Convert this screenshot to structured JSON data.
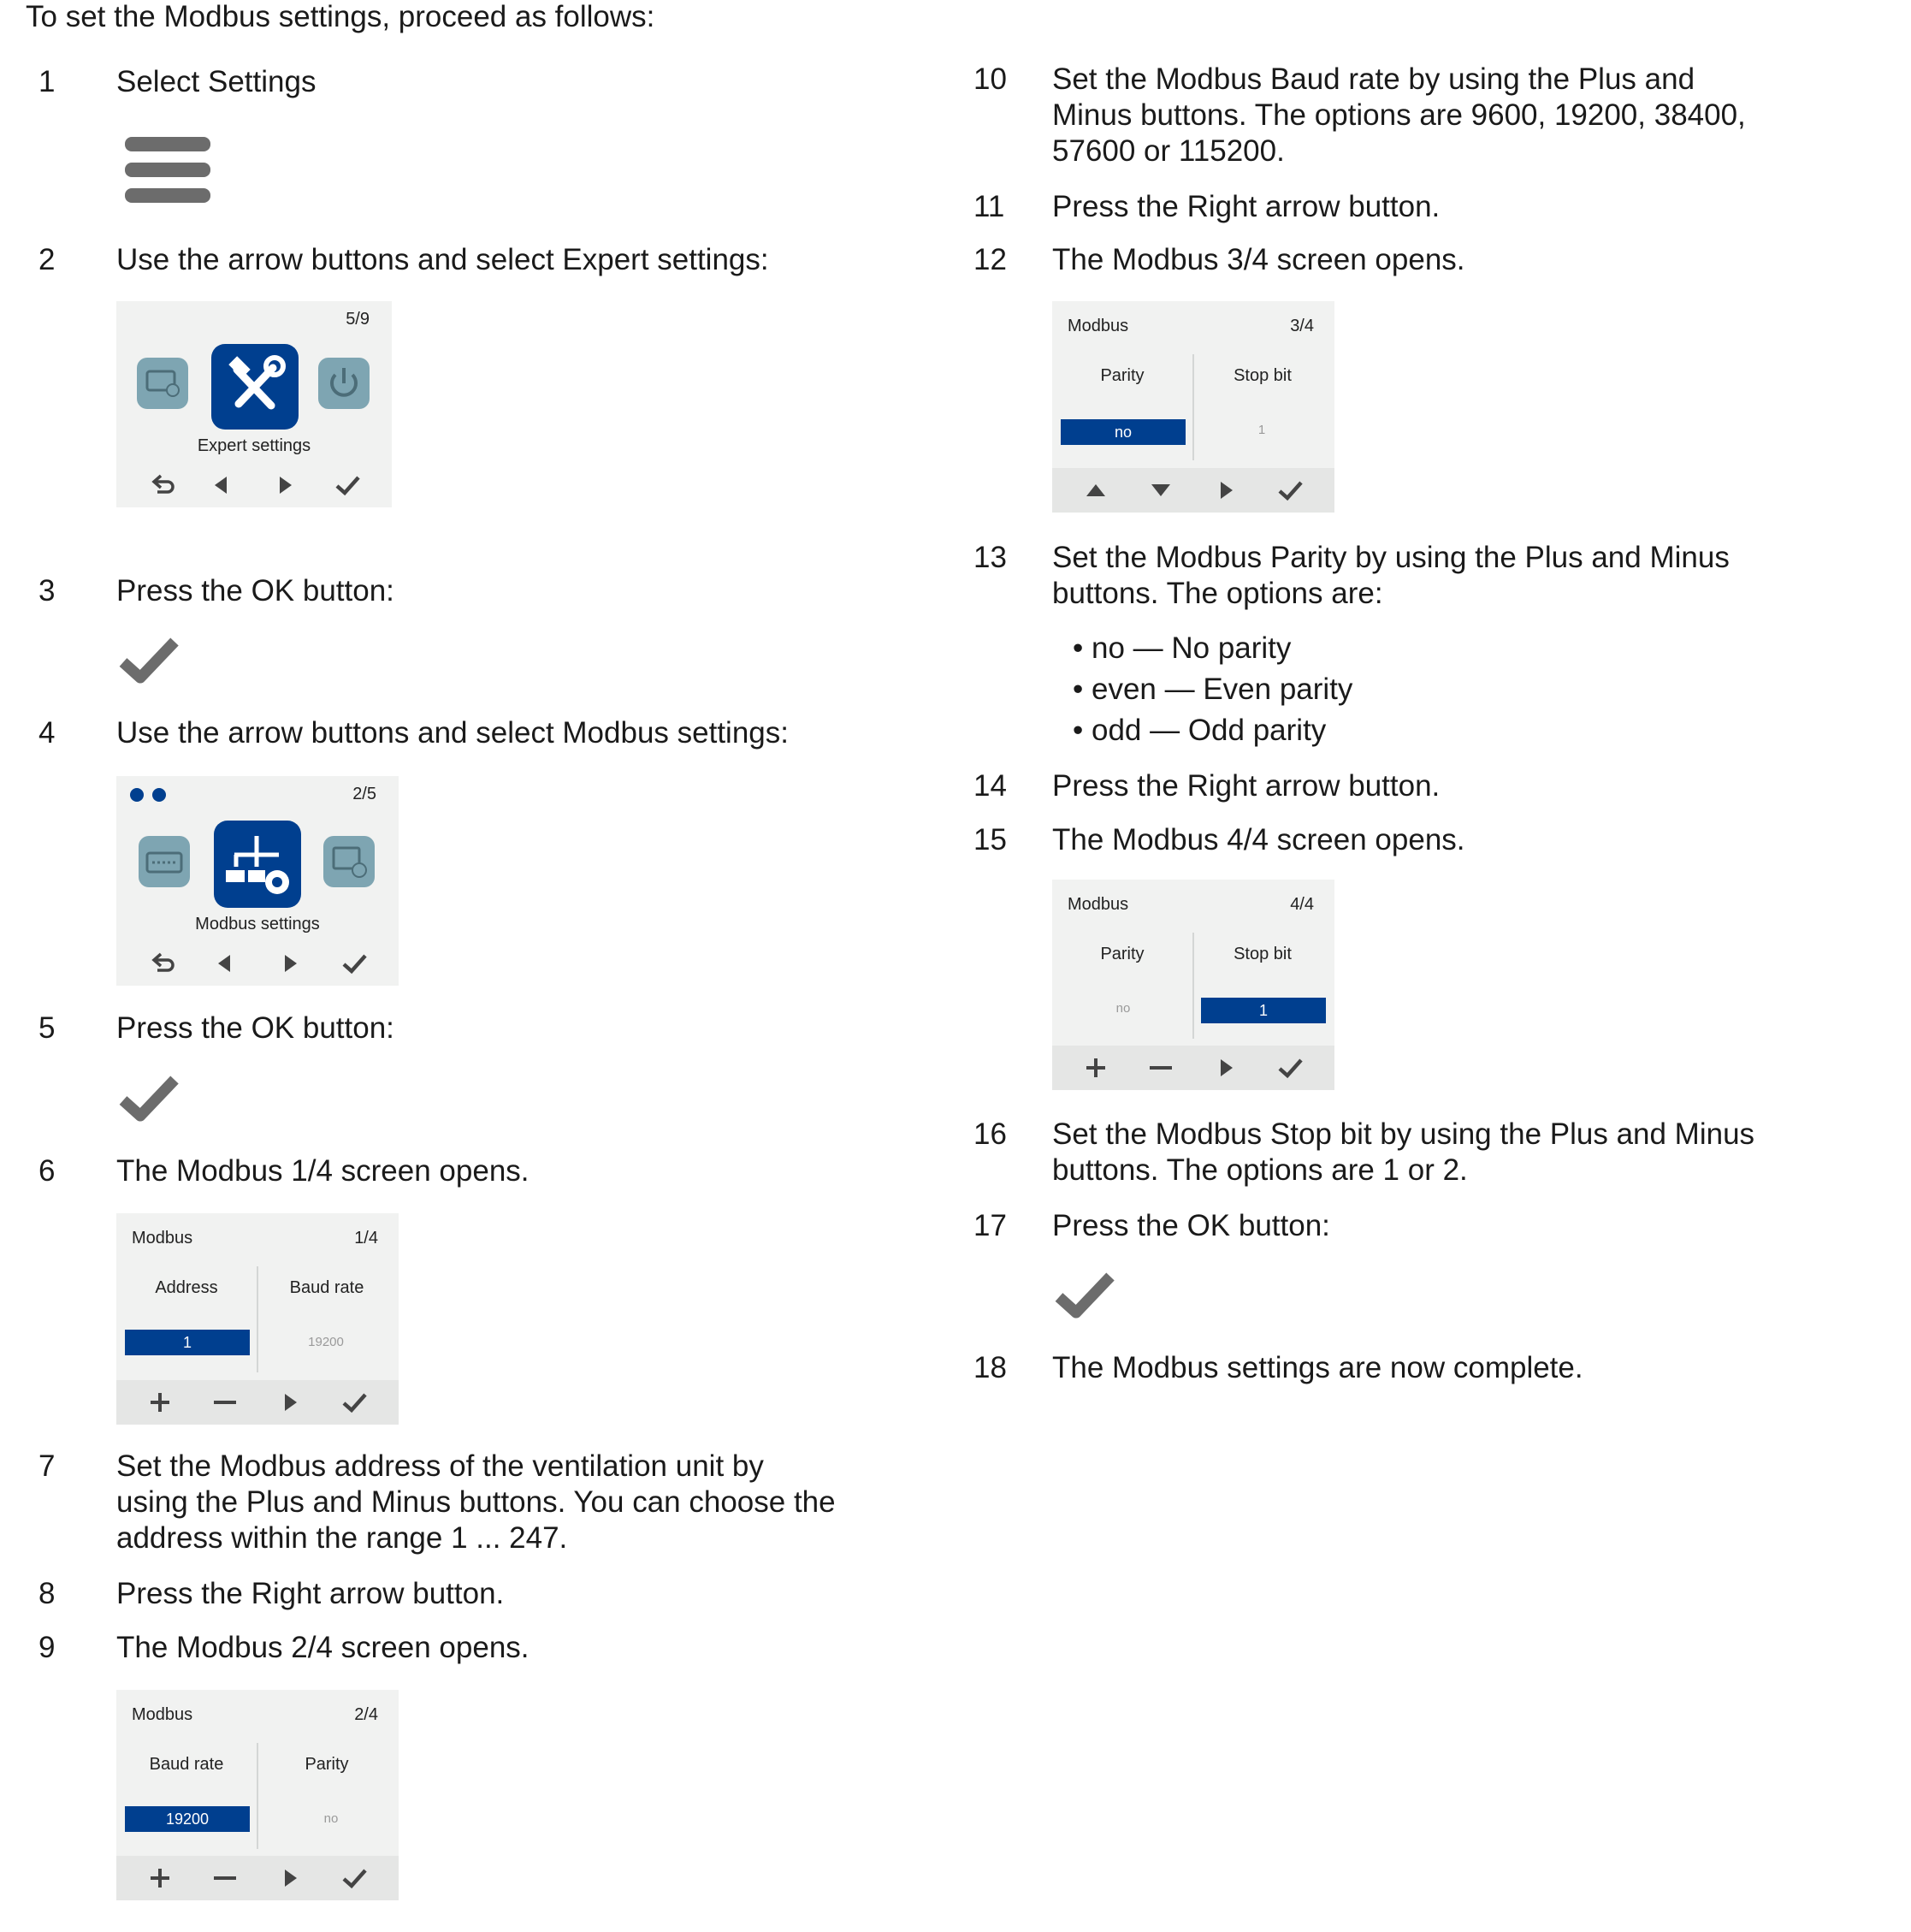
{
  "intro": "To set the Modbus settings, proceed as follows:",
  "steps": {
    "s1": {
      "n": "1",
      "t": "Select Settings"
    },
    "s2": {
      "n": "2",
      "t": "Use the arrow buttons and select Expert settings:"
    },
    "s3": {
      "n": "3",
      "t": "Press the OK button:"
    },
    "s4": {
      "n": "4",
      "t": "Use the arrow buttons and select Modbus settings:"
    },
    "s5": {
      "n": "5",
      "t": "Press the OK button:"
    },
    "s6": {
      "n": "6",
      "t": "The Modbus 1/4 screen opens."
    },
    "s7": {
      "n": "7",
      "t1": "Set the Modbus address of the ventilation unit by",
      "t2": "using the Plus and Minus buttons. You can choose the",
      "t3": "address within the range 1 ... 247."
    },
    "s8": {
      "n": "8",
      "t": "Press the Right arrow button."
    },
    "s9": {
      "n": "9",
      "t": "The Modbus 2/4 screen opens."
    },
    "s10": {
      "n": "10",
      "t1": "Set the Modbus Baud rate by using the Plus and",
      "t2": "Minus buttons. The options are 9600, 19200, 38400,",
      "t3": "57600 or 115200."
    },
    "s11": {
      "n": "11",
      "t": "Press the Right arrow button."
    },
    "s12": {
      "n": "12",
      "t": "The Modbus 3/4 screen opens."
    },
    "s13": {
      "n": "13",
      "t1": "Set the Modbus Parity by using the Plus and Minus",
      "t2": "buttons. The options are:",
      "bullets": [
        "• no — No parity",
        "• even — Even parity",
        "• odd — Odd parity"
      ]
    },
    "s14": {
      "n": "14",
      "t": "Press the Right arrow button."
    },
    "s15": {
      "n": "15",
      "t": "The Modbus 4/4 screen opens."
    },
    "s16": {
      "n": "16",
      "t1": "Set the Modbus Stop bit by using the Plus and Minus",
      "t2": "buttons. The options are 1 or 2."
    },
    "s17": {
      "n": "17",
      "t": "Press the OK button:"
    },
    "s18": {
      "n": "18",
      "t": "The Modbus settings are now complete."
    }
  },
  "screens": {
    "expert": {
      "page": "5/9",
      "caption": "Expert settings"
    },
    "modbusSel": {
      "page": "2/5",
      "caption": "Modbus settings"
    },
    "m1": {
      "title": "Modbus",
      "page": "1/4",
      "left_label": "Address",
      "right_label": "Baud rate",
      "left_value": "1",
      "right_value": "19200"
    },
    "m2": {
      "title": "Modbus",
      "page": "2/4",
      "left_label": "Baud rate",
      "right_label": "Parity",
      "left_value": "19200",
      "right_value": "no"
    },
    "m3": {
      "title": "Modbus",
      "page": "3/4",
      "left_label": "Parity",
      "right_label": "Stop bit",
      "left_value": "no",
      "right_value": "1"
    },
    "m4": {
      "title": "Modbus",
      "page": "4/4",
      "left_label": "Parity",
      "right_label": "Stop bit",
      "left_value": "no",
      "right_value": "1"
    }
  },
  "icons": {
    "menu": "menu-icon",
    "ok": "check-icon",
    "back": "back-icon",
    "left": "arrow-left-icon",
    "right": "arrow-right-icon",
    "up": "arrow-up-icon",
    "down": "arrow-down-icon",
    "plus": "plus-icon",
    "minus": "minus-icon",
    "power": "power-icon",
    "tools": "tools-icon"
  },
  "colors": {
    "accent": "#003f8f",
    "screen_bg": "#f1f2f1",
    "bar_bg": "#e5e6e5",
    "icon_grey": "#6c6c6c",
    "app_icon": "#7ea5b2"
  }
}
